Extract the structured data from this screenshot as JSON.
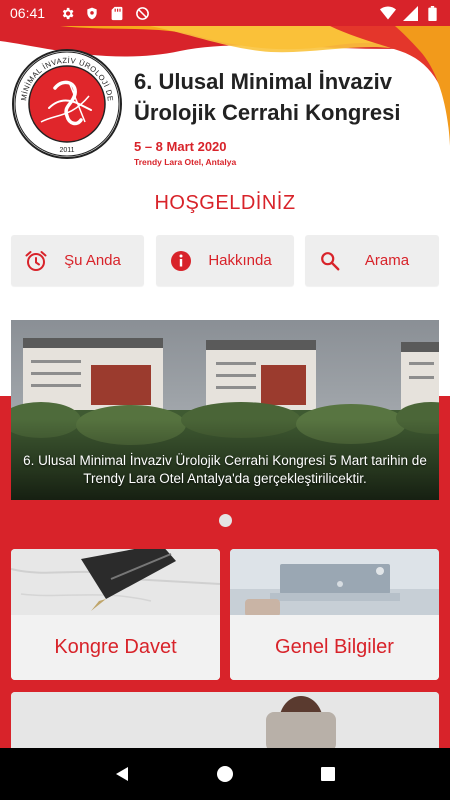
{
  "status_bar": {
    "time": "06:41",
    "left_icons": [
      "gear-icon",
      "shield-icon",
      "sd-card-icon",
      "no-disturb-icon"
    ],
    "right_icons": [
      "wifi-icon",
      "signal-icon",
      "battery-icon"
    ]
  },
  "header": {
    "logo_ring_text": "MİNİMAL İNVAZİV ÜROLOJİ DERNEĞİ",
    "logo_year": "2011",
    "title": "6. Ulusal Minimal İnvaziv Ürolojik Cerrahi Kongresi",
    "date": "5 – 8 Mart 2020",
    "venue": "Trendy Lara Otel, Antalya"
  },
  "welcome": "HOŞGELDİNİZ",
  "quick_actions": [
    {
      "label": "Şu Anda",
      "icon": "alarm-clock-icon"
    },
    {
      "label": "Hakkında",
      "icon": "info-icon"
    },
    {
      "label": "Arama",
      "icon": "search-icon"
    }
  ],
  "carousel": {
    "caption": "6. Ulusal Minimal İnvaziv Ürolojik Cerrahi Kongresi 5 Mart tarihin de Trendy Lara Otel Antalya'da gerçekleştirilicektir.",
    "page_count": 1,
    "current_page": 1
  },
  "cards": [
    {
      "label": "Kongre Davet",
      "image": "fountain-pen-photo"
    },
    {
      "label": "Genel Bilgiler",
      "image": "laptop-photo"
    }
  ],
  "nav_bar": [
    "back-icon",
    "home-icon",
    "recents-icon"
  ],
  "colors": {
    "accent": "#d8232a",
    "button_bg": "#eeeeee",
    "nav_bg": "#000000"
  }
}
